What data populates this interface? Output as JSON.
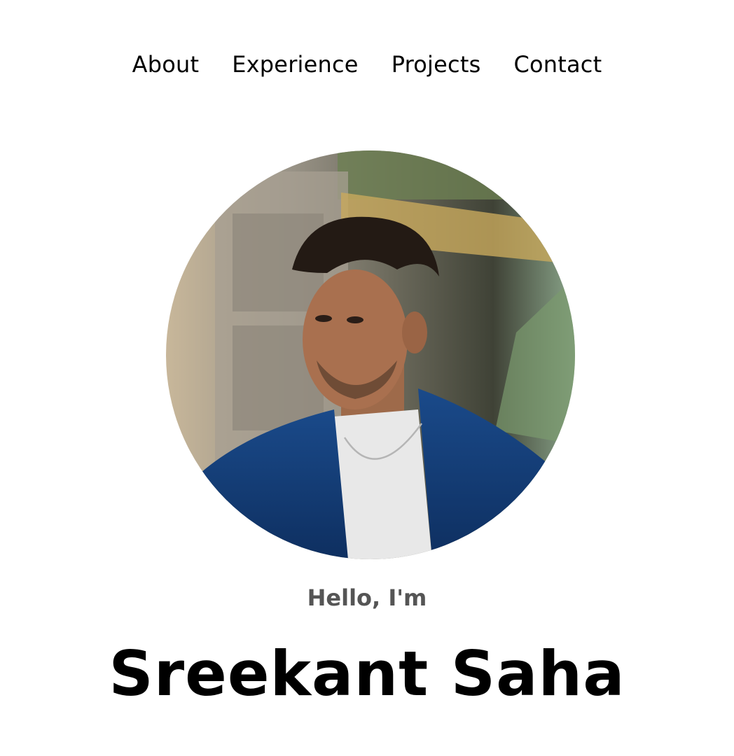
{
  "nav": {
    "items": [
      {
        "label": "About"
      },
      {
        "label": "Experience"
      },
      {
        "label": "Projects"
      },
      {
        "label": "Contact"
      }
    ]
  },
  "hero": {
    "greeting": "Hello, I'm",
    "name": "Sreekant Saha"
  },
  "colors": {
    "text": "#000000",
    "greeting": "#555555",
    "background": "#ffffff",
    "jacket": "#123f7a"
  }
}
